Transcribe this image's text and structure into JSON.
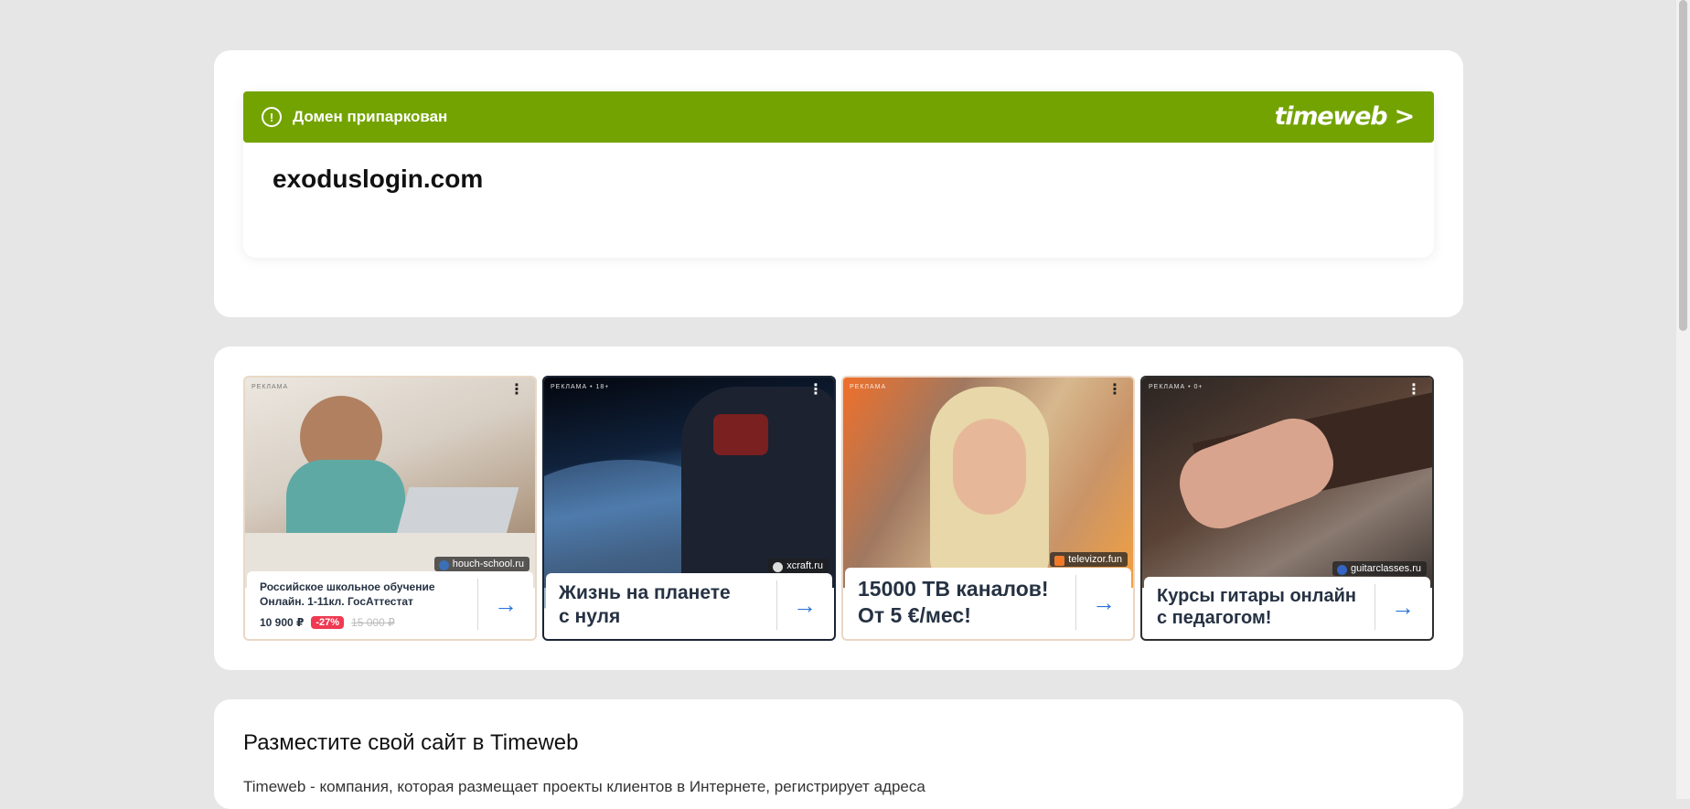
{
  "parked": {
    "banner_text": "Домен припаркован",
    "brand": "timeweb >",
    "domain": "exoduslogin.com"
  },
  "ads": [
    {
      "tag": "РЕКЛАМА",
      "source": "houch-school.ru",
      "title": "Российское школьное обучение Онлайн. 1-11кл. ГосАттестат",
      "price": "10 900 ₽",
      "discount": "-27%",
      "old_price": "15 000 ₽"
    },
    {
      "tag": "РЕКЛАМА • 18+",
      "source": "xcraft.ru",
      "title_line1": "Жизнь на планете",
      "title_line2": "с нуля"
    },
    {
      "tag": "РЕКЛАМА",
      "source": "televizor.fun",
      "title_line1": "15000 ТВ каналов!",
      "title_line2": "От 5 €/мес!"
    },
    {
      "tag": "РЕКЛАМА • 0+",
      "source": "guitarclasses.ru",
      "title_line1": "Курсы гитары онлайн",
      "title_line2": "с педагогом!"
    }
  ],
  "info": {
    "title": "Разместите свой сайт в Timeweb",
    "text": "Timeweb - компания, которая размещает проекты клиентов в Интернете, регистрирует адреса"
  },
  "icons": {
    "warning": "warning-icon",
    "menu": "more-vertical-icon",
    "arrow": "arrow-right-icon"
  },
  "colors": {
    "banner": "#73a300",
    "background": "#e6e6e6",
    "arrow": "#2a74d6",
    "discount": "#ef3a52"
  }
}
